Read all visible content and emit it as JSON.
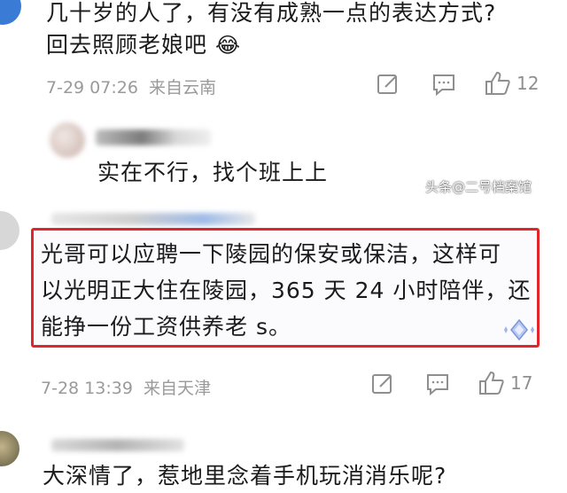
{
  "comment1": {
    "text_line1": "几十岁的人了，有没有成熟一点的表达方式?",
    "text_line2": "回去照顾老娘吧",
    "emoji": "😂",
    "date": "7-29 07:26",
    "location": "来自云南",
    "like_count": "12"
  },
  "reply1": {
    "username": "",
    "text": "实在不行，找个班上上"
  },
  "watermark": "头条@二号档案馆",
  "comment2": {
    "text_line1": "光哥可以应聘一下陵园的保安或保洁，这样可",
    "text_line2": "以光明正大住在陵园，365 天 24 小时陪伴，还",
    "text_line3": "能挣一份工资供养老 s。",
    "highlight_color": "#e0262a",
    "date": "7-28 13:39",
    "location": "来自天津",
    "like_count": "17"
  },
  "comment3": {
    "username": "",
    "text_partial": "大深情了，惹地里念着手机玩消消乐呢?"
  },
  "icons": {
    "edit": "edit-icon",
    "comment": "comment-icon",
    "like": "thumbs-up-icon"
  }
}
